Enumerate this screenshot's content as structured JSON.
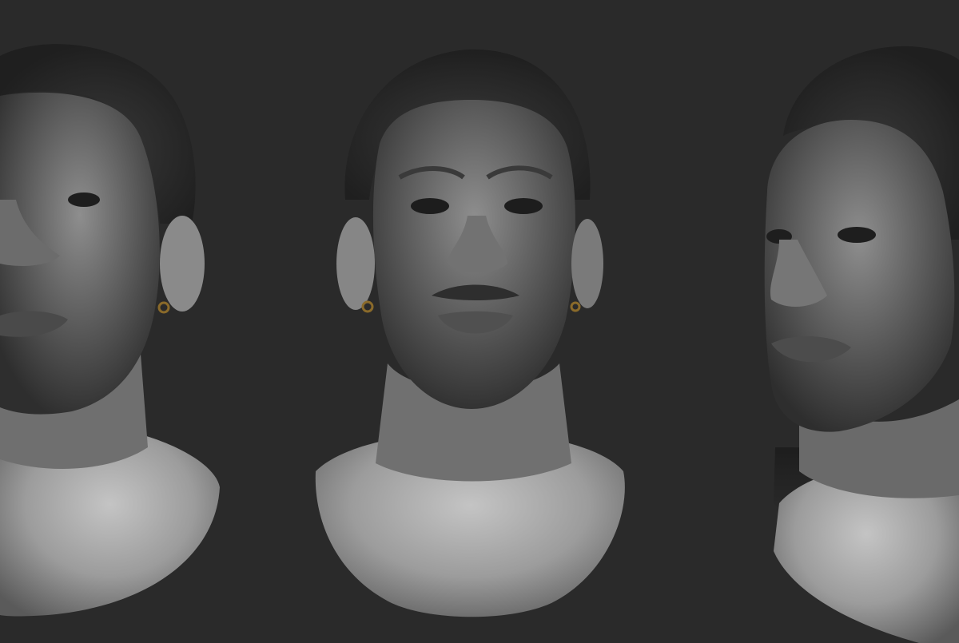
{
  "scene": {
    "background": "#2a2a2a",
    "views": [
      {
        "name": "three-quarter-left-view"
      },
      {
        "name": "front-view"
      },
      {
        "name": "three-quarter-right-view"
      }
    ],
    "colors": {
      "skin_light": "#b9b9b9",
      "skin_mid": "#7a7a7a",
      "skin_dark": "#3a3a3a",
      "hair": "#2b2b2b",
      "earring": "#8a6a2a"
    }
  }
}
